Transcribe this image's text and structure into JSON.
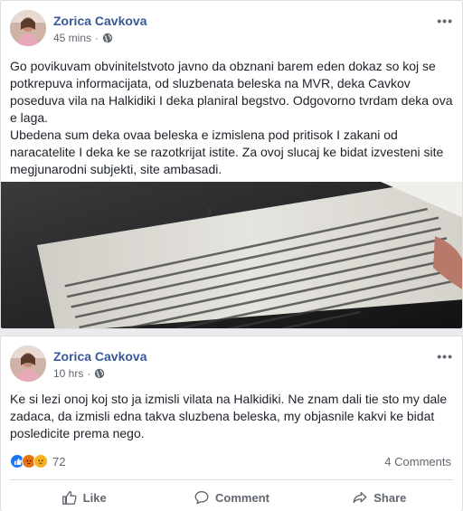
{
  "post1": {
    "author": "Zorica Cavkova",
    "time": "45 mins",
    "privacy_icon": "globe-icon",
    "more_icon": "•••",
    "paragraph1": "Go povikuvam obvinitelstvoto javno da obznani barem eden dokaz so koj se potkrepuva informacijata, od sluzbenata beleska na MVR, deka Cavkov poseduva vila na Halkidiki I deka planiral begstvo. Odgovorno tvrdam deka ova e laga.",
    "paragraph2": "Ubedena sum deka ovaa beleska e izmislena pod pritisok I zakani od naracatelite I deka ke se razotkrijat istite. Za ovoj slucaj ke bidat izvesteni site megjunarodni subjekti, site ambasadi."
  },
  "post2": {
    "author": "Zorica Cavkova",
    "time": "10 hrs",
    "privacy_icon": "globe-icon",
    "more_icon": "•••",
    "text": "Ke si lezi onoj koj sto ja izmisli vilata na Halkidiki. Ne znam dali tie sto my dale zadaca, da izmisli edna takva sluzbena beleska, my objasnile kakvi ke bidat posledicite prema nego.",
    "reactions_count": "72",
    "comments_count": "4 Comments",
    "actions": {
      "like": "Like",
      "comment": "Comment",
      "share": "Share"
    }
  },
  "colors": {
    "name": "#385898",
    "like": "#1877f2",
    "angry": "#e9710f",
    "sad": "#f7b125"
  }
}
